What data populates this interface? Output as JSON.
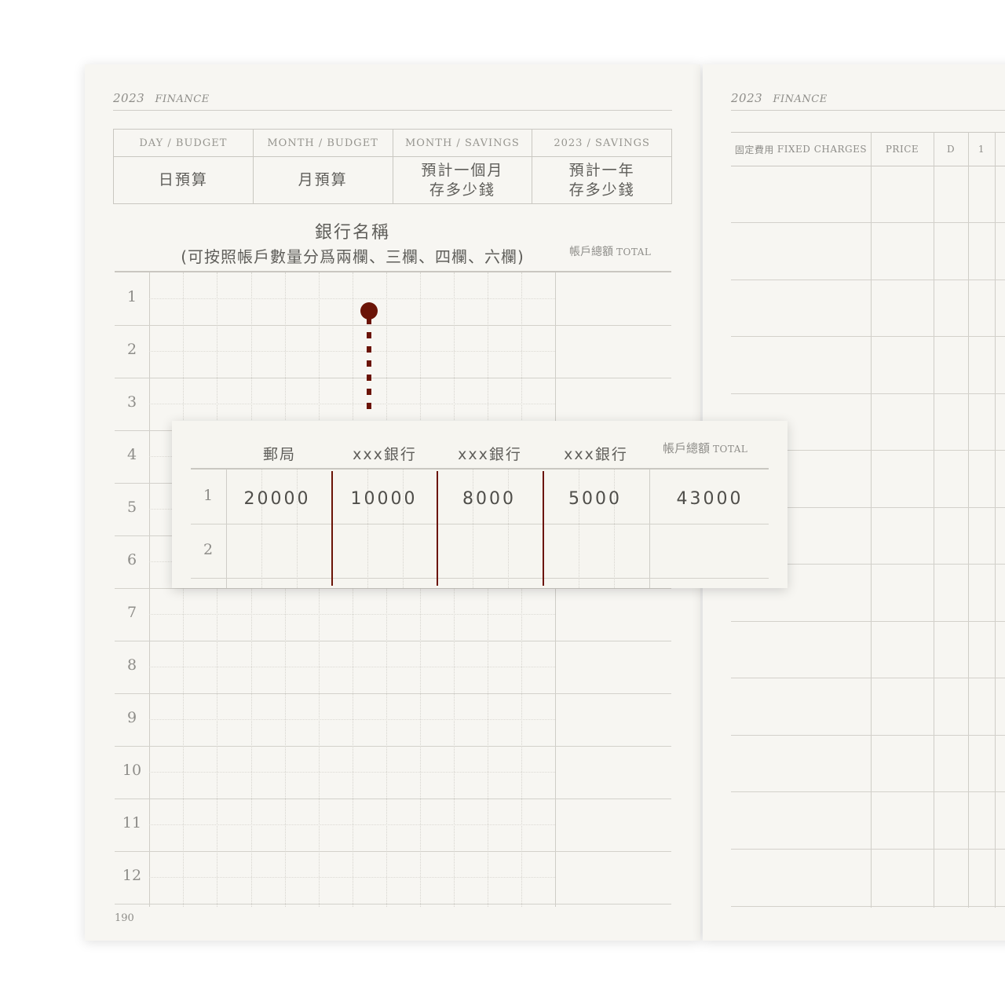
{
  "header": {
    "year": "2023",
    "label": "FINANCE"
  },
  "budget": [
    {
      "en": "DAY / BUDGET",
      "zh": "日預算"
    },
    {
      "en": "MONTH / BUDGET",
      "zh": "月預算"
    },
    {
      "en": "MONTH / SAVINGS",
      "zh": "預計一個月\n存多少錢"
    },
    {
      "en": "2023 / SAVINGS",
      "zh": "預計一年\n存多少錢"
    }
  ],
  "bank": {
    "title": "銀行名稱",
    "subtitle": "(可按照帳戶數量分爲兩欄、三欄、四欄、六欄)",
    "total_zh": "帳戶總額",
    "total_en": "TOTAL"
  },
  "rows": [
    "1",
    "2",
    "3",
    "4",
    "5",
    "6",
    "7",
    "8",
    "9",
    "10",
    "11",
    "12"
  ],
  "page_number": "190",
  "example": {
    "columns": [
      "郵局",
      "xxx銀行",
      "xxx銀行",
      "xxx銀行"
    ],
    "total_zh": "帳戶總額",
    "total_en": "TOTAL",
    "rows": [
      {
        "num": "1",
        "values": [
          "20000",
          "10000",
          "8000",
          "5000"
        ],
        "total": "43000"
      },
      {
        "num": "2",
        "values": [
          "",
          "",
          "",
          ""
        ],
        "total": ""
      }
    ]
  },
  "fixed": {
    "header_zh": "固定費用",
    "header_en": "FIXED CHARGES",
    "price": "PRICE",
    "d": "D",
    "one": "1"
  },
  "colors": {
    "accent": "#6b1407",
    "paper": "#f7f6f2",
    "line": "#cfcdc7"
  }
}
